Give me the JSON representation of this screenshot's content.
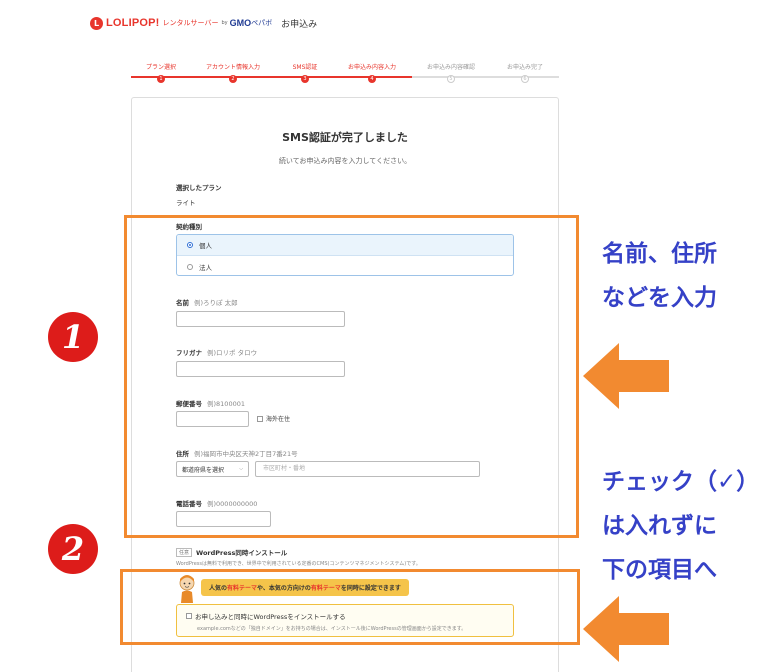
{
  "header": {
    "logo_mark": "L",
    "logo": "LOLIPOP!",
    "logo_sub": "レンタルサーバー",
    "logo_by": "by",
    "logo_gmo": "GMO",
    "logo_pepabo": "ペパボ",
    "title": "お申込み"
  },
  "steps": [
    {
      "label": "プラン選択",
      "num": "1",
      "state": "done"
    },
    {
      "label": "アカウント情報入力",
      "num": "2",
      "state": "done"
    },
    {
      "label": "SMS認証",
      "num": "3",
      "state": "done"
    },
    {
      "label": "お申込み内容入力",
      "num": "4",
      "state": "done"
    },
    {
      "label": "お申込み内容確認",
      "num": "5",
      "state": "todo"
    },
    {
      "label": "お申込み完了",
      "num": "6",
      "state": "todo"
    }
  ],
  "main": {
    "title": "SMS認証が完了しました",
    "subtitle": "続いてお申込み内容を入力してください。"
  },
  "plan": {
    "label": "選択したプラン",
    "value": "ライト"
  },
  "contract": {
    "label": "契約種別",
    "options": [
      "個人",
      "法人"
    ],
    "selected": "個人"
  },
  "fields": {
    "name": {
      "label": "名前",
      "example": "例)ろりぽ 太郎",
      "value": ""
    },
    "furigana": {
      "label": "フリガナ",
      "example": "例)ロリポ タロウ",
      "value": ""
    },
    "postal": {
      "label": "郵便番号",
      "example": "例)8100001",
      "value": "",
      "overseas_label": "海外在住"
    },
    "address": {
      "label": "住所",
      "example": "例)福岡市中央区天神2丁目7番21号",
      "prefecture_placeholder": "都道府県を選択",
      "city_placeholder": "市区町村・番地"
    },
    "phone": {
      "label": "電話番号",
      "example": "例)0000000000",
      "value": ""
    }
  },
  "wordpress": {
    "tag": "任意",
    "title": "WordPress同時インストール",
    "description": "WordPressは無料で利用でき、世界中で利用されている定番のCMS(コンテンツマネジメントシステム)です。",
    "banner_pre": "人気の",
    "banner_hl1": "有料テーマ",
    "banner_mid": "や、本気の方向けの",
    "banner_hl2": "有料テーマ",
    "banner_post": "を同時に設定できます",
    "checkbox_label": "お申し込みと同時にWordPressをインストールする",
    "note": "example.comなどの「独自ドメイン」をお持ちの場合は、インストール後にWordPressの管理画面から設定できます。"
  },
  "annotations": {
    "badge_1": "1",
    "badge_2": "2",
    "note_1": [
      "名前、住所",
      "などを入力"
    ],
    "note_2": [
      "チェック（✓）",
      "は入れずに",
      "下の項目へ"
    ]
  },
  "colors": {
    "brand": "#e8352c",
    "annotation_frame": "#f28a30",
    "annotation_text": "#3541c7",
    "badge": "#dd1c1a"
  }
}
